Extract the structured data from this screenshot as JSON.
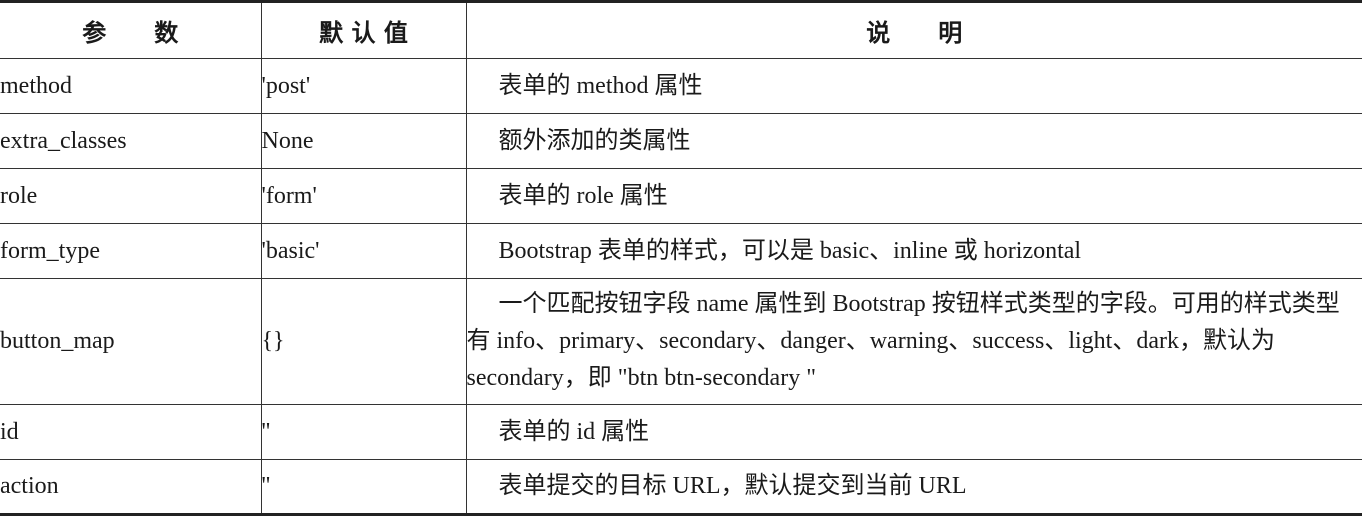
{
  "table": {
    "headers": {
      "param": "参　　数",
      "default": "默 认 值",
      "desc": "说　　明"
    },
    "rows": [
      {
        "param": "method",
        "default": "'post'",
        "desc": "表单的 method 属性"
      },
      {
        "param": "extra_classes",
        "default": "None",
        "desc": "额外添加的类属性"
      },
      {
        "param": "role",
        "default": "'form'",
        "desc": "表单的 role 属性"
      },
      {
        "param": "form_type",
        "default": "'basic'",
        "desc": "Bootstrap 表单的样式，可以是 basic、inline 或 horizontal"
      },
      {
        "param": "button_map",
        "default": "{}",
        "desc": "一个匹配按钮字段 name 属性到 Bootstrap 按钮样式类型的字段。可用的样式类型有 info、primary、secondary、danger、warning、success、light、dark，默认为 secondary，即 \"btn btn-secondary \""
      },
      {
        "param": "id",
        "default": "''",
        "desc": "表单的 id 属性"
      },
      {
        "param": "action",
        "default": "''",
        "desc": "表单提交的目标 URL，默认提交到当前 URL"
      }
    ]
  }
}
